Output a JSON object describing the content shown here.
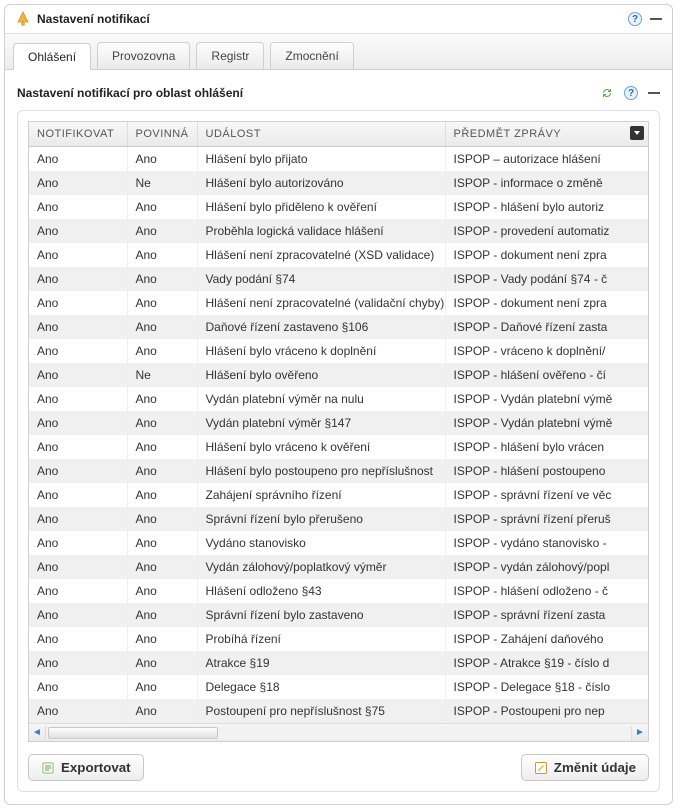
{
  "window": {
    "title": "Nastavení notifikací"
  },
  "tabs": [
    {
      "label": "Ohlášení",
      "active": true
    },
    {
      "label": "Provozovna",
      "active": false
    },
    {
      "label": "Registr",
      "active": false
    },
    {
      "label": "Zmocnění",
      "active": false
    }
  ],
  "section": {
    "title": "Nastavení notifikací pro oblast ohlášení"
  },
  "columns": {
    "notifikovat": "NOTIFIKOVAT",
    "povinna": "POVINNÁ",
    "udalost": "UDÁLOST",
    "predmet": "PŘEDMĚT ZPRÁVY"
  },
  "rows": [
    {
      "notifikovat": "Ano",
      "povinna": "Ano",
      "udalost": "Hlášení bylo přijato",
      "predmet": "ISPOP – autorizace hlášení"
    },
    {
      "notifikovat": "Ano",
      "povinna": "Ne",
      "udalost": "Hlášení bylo autorizováno",
      "predmet": "ISPOP - informace o změně"
    },
    {
      "notifikovat": "Ano",
      "povinna": "Ano",
      "udalost": "Hlášení bylo přiděleno k ověření",
      "predmet": "ISPOP - hlášení bylo autoriz"
    },
    {
      "notifikovat": "Ano",
      "povinna": "Ano",
      "udalost": "Proběhla logická validace hlášení",
      "predmet": "ISPOP - provedení automatiz"
    },
    {
      "notifikovat": "Ano",
      "povinna": "Ano",
      "udalost": "Hlášení není zpracovatelné (XSD validace)",
      "predmet": "ISPOP - dokument není zpra"
    },
    {
      "notifikovat": "Ano",
      "povinna": "Ano",
      "udalost": "Vady podání §74",
      "predmet": "ISPOP - Vady podání §74 - č"
    },
    {
      "notifikovat": "Ano",
      "povinna": "Ano",
      "udalost": "Hlášení není zpracovatelné (validační chyby)",
      "predmet": "ISPOP - dokument není zpra"
    },
    {
      "notifikovat": "Ano",
      "povinna": "Ano",
      "udalost": "Daňové řízení zastaveno §106",
      "predmet": "ISPOP - Daňové řízení zasta"
    },
    {
      "notifikovat": "Ano",
      "povinna": "Ano",
      "udalost": "Hlášení bylo vráceno k doplnění",
      "predmet": "ISPOP - vráceno k doplnění/"
    },
    {
      "notifikovat": "Ano",
      "povinna": "Ne",
      "udalost": "Hlášení bylo ověřeno",
      "predmet": "ISPOP - hlášení ověřeno - čí"
    },
    {
      "notifikovat": "Ano",
      "povinna": "Ano",
      "udalost": "Vydán platební výměr na nulu",
      "predmet": "ISPOP - Vydán platební výmě"
    },
    {
      "notifikovat": "Ano",
      "povinna": "Ano",
      "udalost": "Vydán platební výměr §147",
      "predmet": "ISPOP - Vydán platební výmě"
    },
    {
      "notifikovat": "Ano",
      "povinna": "Ano",
      "udalost": "Hlášení bylo vráceno k ověření",
      "predmet": "ISPOP - hlášení bylo vrácen"
    },
    {
      "notifikovat": "Ano",
      "povinna": "Ano",
      "udalost": "Hlášení bylo postoupeno pro nepříslušnost",
      "predmet": "ISPOP - hlášení postoupeno"
    },
    {
      "notifikovat": "Ano",
      "povinna": "Ano",
      "udalost": "Zahájení správního řízení",
      "predmet": "ISPOP - správní řízení ve věc"
    },
    {
      "notifikovat": "Ano",
      "povinna": "Ano",
      "udalost": "Správní řízení bylo přerušeno",
      "predmet": "ISPOP - správní řízení přeruš"
    },
    {
      "notifikovat": "Ano",
      "povinna": "Ano",
      "udalost": "Vydáno stanovisko",
      "predmet": "ISPOP - vydáno stanovisko -"
    },
    {
      "notifikovat": "Ano",
      "povinna": "Ano",
      "udalost": "Vydán zálohový/poplatkový výměr",
      "predmet": "ISPOP - vydán zálohový/popl"
    },
    {
      "notifikovat": "Ano",
      "povinna": "Ano",
      "udalost": "Hlášení odloženo §43",
      "predmet": "ISPOP - hlášení odloženo - č"
    },
    {
      "notifikovat": "Ano",
      "povinna": "Ano",
      "udalost": "Správní řízení bylo zastaveno",
      "predmet": "ISPOP - správní řízení zasta"
    },
    {
      "notifikovat": "Ano",
      "povinna": "Ano",
      "udalost": "Probíhá řízení",
      "predmet": "ISPOP - Zahájení daňového"
    },
    {
      "notifikovat": "Ano",
      "povinna": "Ano",
      "udalost": "Atrakce §19",
      "predmet": "ISPOP - Atrakce §19 - číslo d"
    },
    {
      "notifikovat": "Ano",
      "povinna": "Ano",
      "udalost": "Delegace §18",
      "predmet": "ISPOP - Delegace §18 - číslo"
    },
    {
      "notifikovat": "Ano",
      "povinna": "Ano",
      "udalost": "Postoupení pro nepříslušnost §75",
      "predmet": "ISPOP - Postoupeni pro nep"
    }
  ],
  "buttons": {
    "export": "Exportovat",
    "edit": "Změnit údaje"
  }
}
